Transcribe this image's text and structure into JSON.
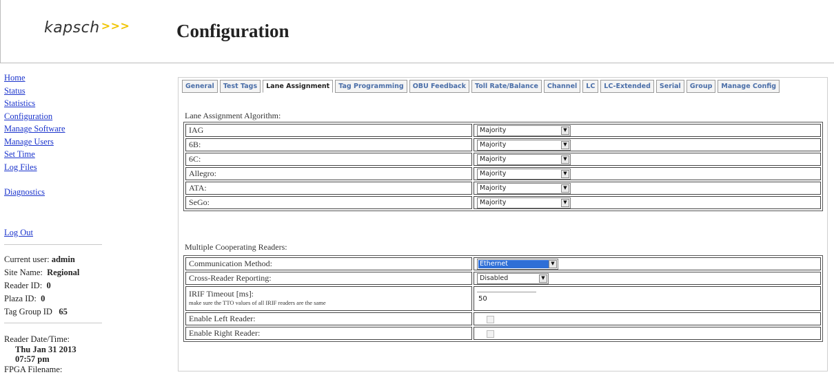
{
  "header": {
    "logo_text": "kapsch",
    "logo_mark": ">>>",
    "title": "Configuration"
  },
  "nav": {
    "links": [
      "Home",
      "Status",
      "Statistics",
      "Configuration",
      "Manage Software",
      "Manage Users",
      "Set Time",
      "Log Files"
    ],
    "diagnostics": "Diagnostics",
    "logout": "Log Out"
  },
  "info": {
    "current_user_label": "Current user:",
    "current_user": "admin",
    "site_name_label": "Site Name:",
    "site_name": "Regional",
    "reader_id_label": "Reader ID:",
    "reader_id": "0",
    "plaza_id_label": "Plaza ID:",
    "plaza_id": "0",
    "tag_group_label": "Tag Group ID",
    "tag_group": "65",
    "reader_datetime_label": "Reader Date/Time:",
    "reader_date": "Thu Jan 31 2013",
    "reader_time": "07:57 pm",
    "fpga_label": "FPGA Filename:"
  },
  "tabs": [
    "General",
    "Test Tags",
    "Lane Assignment",
    "Tag Programming",
    "OBU Feedback",
    "Toll Rate/Balance",
    "Channel",
    "LC",
    "LC-Extended",
    "Serial",
    "Group",
    "Manage Config"
  ],
  "active_tab": "Lane Assignment",
  "lane_assignment": {
    "heading": "Lane Assignment Algorithm:",
    "rows": [
      {
        "label": "IAG",
        "value": "Majority"
      },
      {
        "label": "6B:",
        "value": "Majority"
      },
      {
        "label": "6C:",
        "value": "Majority"
      },
      {
        "label": "Allegro:",
        "value": "Majority"
      },
      {
        "label": "ATA:",
        "value": "Majority"
      },
      {
        "label": "SeGo:",
        "value": "Majority"
      }
    ]
  },
  "mcr": {
    "heading": "Multiple Cooperating Readers:",
    "comm_label": "Communication Method:",
    "comm_value": "Ethernet",
    "cross_label": "Cross-Reader Reporting:",
    "cross_value": "Disabled",
    "irif_label": "IRIF Timeout [ms]:",
    "irif_note": "make sure the TTO values of all IRIF readers are the same",
    "irif_value": "50",
    "left_label": "Enable Left Reader:",
    "left_checked": false,
    "right_label": "Enable Right Reader:",
    "right_checked": false
  },
  "colors": {
    "link": "#1a33cc",
    "tab_text": "#4a6ea8",
    "highlight": "#2f6fd6",
    "logo_arrows": "#f0c400"
  }
}
